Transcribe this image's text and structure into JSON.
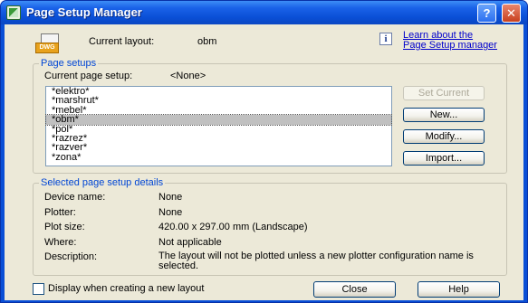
{
  "window": {
    "title": "Page Setup Manager",
    "help_glyph": "?",
    "close_glyph": "✕"
  },
  "header": {
    "icon_tag": "DWG",
    "current_layout_label": "Current layout:",
    "current_layout_value": "obm",
    "info_glyph": "i",
    "learn_link_line1": "Learn about the",
    "learn_link_line2": "Page Setup manager"
  },
  "page_setups": {
    "group_title": "Page setups",
    "current_label": "Current page setup:",
    "current_value": "<None>",
    "items": [
      "*elektro*",
      "*marshrut*",
      "*mebel*",
      "*obm*",
      "*pol*",
      "*razrez*",
      "*razver*",
      "*zona*"
    ],
    "selected_index": 3,
    "buttons": {
      "set_current": "Set Current",
      "new": "New...",
      "modify": "Modify...",
      "import": "Import..."
    }
  },
  "details": {
    "group_title": "Selected page setup details",
    "rows": [
      {
        "label": "Device name:",
        "value": "None"
      },
      {
        "label": "Plotter:",
        "value": "None"
      },
      {
        "label": "Plot size:",
        "value": "420.00 x 297.00 mm (Landscape)"
      },
      {
        "label": "Where:",
        "value": "Not applicable"
      },
      {
        "label": "Description:",
        "value": "The layout will not be plotted unless a new plotter configuration name is selected."
      }
    ]
  },
  "footer": {
    "checkbox_label": "Display when creating a new layout",
    "checkbox_checked": false,
    "close_label": "Close",
    "help_label": "Help"
  },
  "colors": {
    "titlebar": "#0a4fd6",
    "client": "#ece9d8",
    "group_title": "#0046d5",
    "link": "#0000cc"
  }
}
